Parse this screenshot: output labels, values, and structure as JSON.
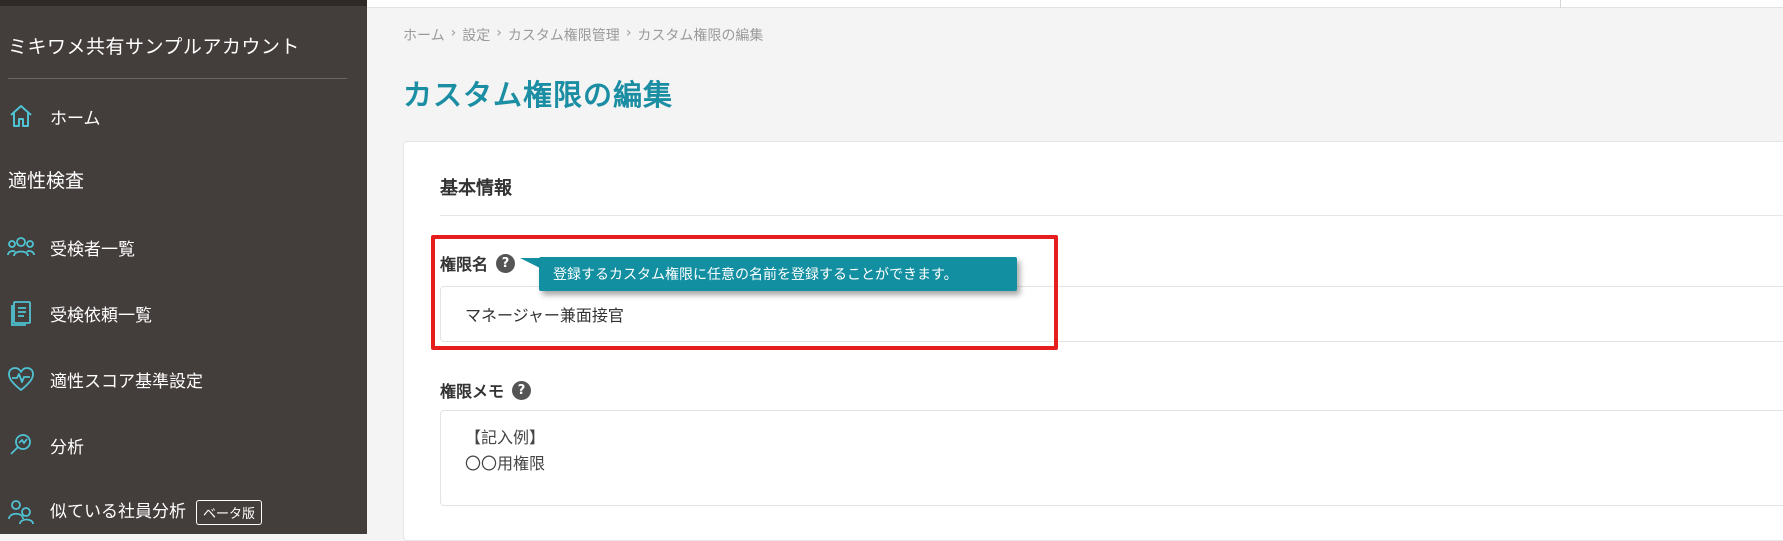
{
  "sidebar": {
    "account_name": "ミキワメ共有サンプルアカウント",
    "home_label": "ホーム",
    "section_title": "適性検査",
    "items": [
      {
        "label": "受検者一覧",
        "icon": "users-icon"
      },
      {
        "label": "受検依頼一覧",
        "icon": "document-list-icon"
      },
      {
        "label": "適性スコア基準設定",
        "icon": "heart-pulse-icon"
      },
      {
        "label": "分析",
        "icon": "magnify-chart-icon"
      },
      {
        "label": "似ている社員分析",
        "icon": "people-compare-icon",
        "badge": "ベータ版"
      }
    ],
    "home_icon": "home-icon"
  },
  "breadcrumb": [
    "ホーム",
    "設定",
    "カスタム権限管理",
    "カスタム権限の編集"
  ],
  "breadcrumb_sep": "›",
  "page_title": "カスタム権限の編集",
  "card": {
    "heading": "基本情報",
    "permission_name": {
      "label": "権限名",
      "help": "?",
      "value": "マネージャー兼面接官",
      "tooltip": "登録するカスタム権限に任意の名前を登録することができます。"
    },
    "permission_memo": {
      "label": "権限メモ",
      "help": "?",
      "placeholder_line1": "【記入例】",
      "placeholder_line2": "〇〇用権限"
    }
  },
  "colors": {
    "sidebar_bg": "#433d3b",
    "accent": "#1b8ea3",
    "tooltip_bg": "#138fa2",
    "highlight": "#e51d1d"
  }
}
